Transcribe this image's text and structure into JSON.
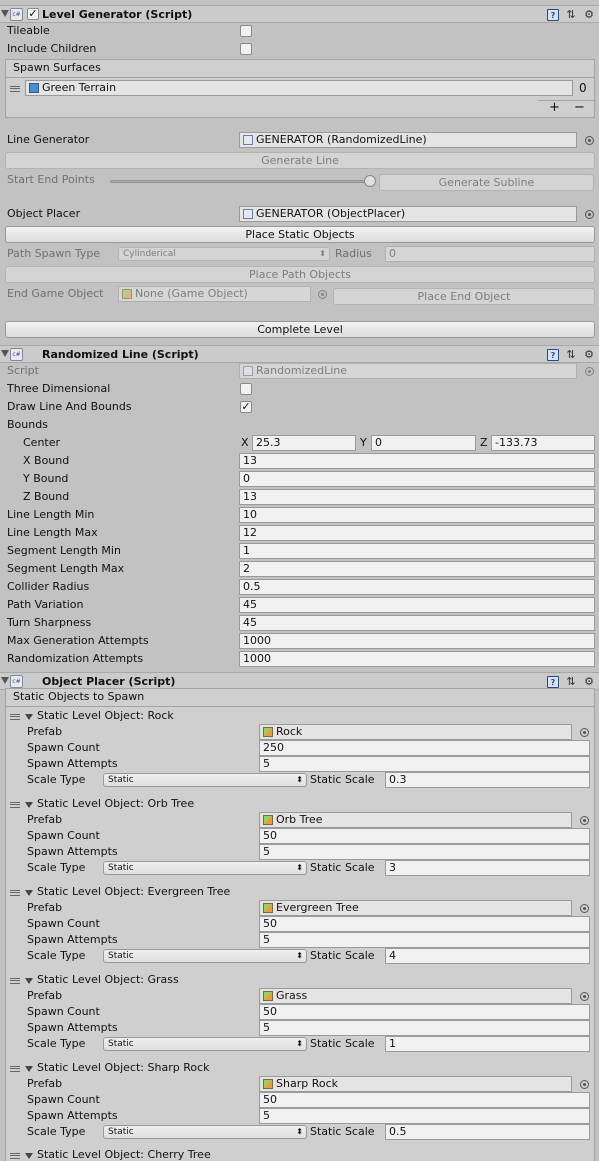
{
  "level_generator": {
    "title": "Level Generator (Script)",
    "tileable_label": "Tileable",
    "include_children_label": "Include Children",
    "spawn_surfaces_label": "Spawn Surfaces",
    "spawn_surface_item": "Green Terrain",
    "spawn_surface_count": "0",
    "add_label": "+",
    "remove_label": "−",
    "line_generator_label": "Line Generator",
    "line_generator_value": "GENERATOR (RandomizedLine)",
    "generate_line_label": "Generate Line",
    "start_end_points_label": "Start End Points",
    "generate_subline_label": "Generate Subline",
    "object_placer_label": "Object Placer",
    "object_placer_value": "GENERATOR (ObjectPlacer)",
    "place_static_label": "Place Static Objects",
    "path_spawn_type_label": "Path Spawn Type",
    "path_spawn_type_value": "Cylinderical",
    "radius_label": "Radius",
    "radius_value": "0",
    "place_path_label": "Place Path Objects",
    "end_game_object_label": "End Game Object",
    "end_game_object_value": "None (Game Object)",
    "place_end_label": "Place End Object",
    "complete_level_label": "Complete Level"
  },
  "randomized_line": {
    "title": "Randomized Line (Script)",
    "script_label": "Script",
    "script_value": "RandomizedLine",
    "three_dimensional_label": "Three Dimensional",
    "draw_line_label": "Draw Line And Bounds",
    "draw_line_checked": true,
    "bounds_label": "Bounds",
    "center_label": "Center",
    "x_label": "X",
    "x_value": "25.3",
    "y_label": "Y",
    "y_value": "0",
    "z_label": "Z",
    "z_value": "-133.73",
    "fields": [
      {
        "label": "X Bound",
        "value": "13"
      },
      {
        "label": "Y Bound",
        "value": "0"
      },
      {
        "label": "Z Bound",
        "value": "13"
      },
      {
        "label": "Line Length Min",
        "value": "10"
      },
      {
        "label": "Line Length Max",
        "value": "12"
      },
      {
        "label": "Segment Length Min",
        "value": "1"
      },
      {
        "label": "Segment Length Max",
        "value": "2"
      },
      {
        "label": "Collider Radius",
        "value": "0.5"
      },
      {
        "label": "Path Variation",
        "value": "45"
      },
      {
        "label": "Turn Sharpness",
        "value": "45"
      },
      {
        "label": "Max Generation Attempts",
        "value": "1000"
      },
      {
        "label": "Randomization Attempts",
        "value": "1000"
      }
    ]
  },
  "object_placer": {
    "title": "Object Placer (Script)",
    "static_objects_label": "Static Objects to Spawn",
    "prefab_label": "Prefab",
    "spawn_count_label": "Spawn Count",
    "spawn_attempts_label": "Spawn Attempts",
    "scale_type_label": "Scale Type",
    "static_scale_label": "Static Scale",
    "items": [
      {
        "title": "Static Level Object: Rock",
        "prefab": "Rock",
        "spawn_count": "250",
        "spawn_attempts": "5",
        "scale_type": "Static",
        "static_scale": "0.3"
      },
      {
        "title": "Static Level Object: Orb Tree",
        "prefab": "Orb Tree",
        "spawn_count": "50",
        "spawn_attempts": "5",
        "scale_type": "Static",
        "static_scale": "3"
      },
      {
        "title": "Static Level Object: Evergreen Tree",
        "prefab": "Evergreen Tree",
        "spawn_count": "50",
        "spawn_attempts": "5",
        "scale_type": "Static",
        "static_scale": "4"
      },
      {
        "title": "Static Level Object: Grass",
        "prefab": "Grass",
        "spawn_count": "50",
        "spawn_attempts": "5",
        "scale_type": "Static",
        "static_scale": "1"
      },
      {
        "title": "Static Level Object: Sharp Rock",
        "prefab": "Sharp Rock",
        "spawn_count": "50",
        "spawn_attempts": "5",
        "scale_type": "Static",
        "static_scale": "0.5"
      }
    ],
    "last_item_title": "Static Level Object: Cherry Tree"
  }
}
